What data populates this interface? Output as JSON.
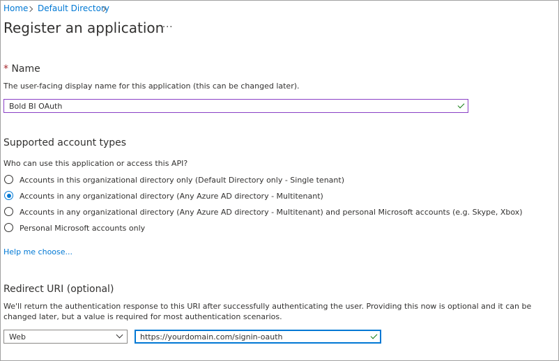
{
  "breadcrumb": {
    "items": [
      "Home",
      "Default Directory"
    ]
  },
  "header": {
    "title": "Register an application",
    "more_label": "···"
  },
  "name_section": {
    "required_marker": "*",
    "label": "Name",
    "description": "The user-facing display name for this application (this can be changed later).",
    "value": "Bold BI OAuth"
  },
  "account_types": {
    "heading": "Supported account types",
    "question": "Who can use this application or access this API?",
    "options": [
      "Accounts in this organizational directory only (Default Directory only - Single tenant)",
      "Accounts in any organizational directory (Any Azure AD directory - Multitenant)",
      "Accounts in any organizational directory (Any Azure AD directory - Multitenant) and personal Microsoft accounts (e.g. Skype, Xbox)",
      "Personal Microsoft accounts only"
    ],
    "selected_index": 1,
    "help_link": "Help me choose..."
  },
  "redirect": {
    "heading": "Redirect URI (optional)",
    "description_line1": "We'll return the authentication response to this URI after successfully authenticating the user. Providing this now is optional and it can be",
    "description_line2": "changed later, but a value is required for most authentication scenarios.",
    "platform_value": "Web",
    "uri_value": "https://yourdomain.com/signin-oauth"
  },
  "colors": {
    "accent": "#0078d4",
    "success": "#107c10",
    "required": "#a4262c",
    "focus_purple": "#8a3fc5"
  },
  "icons": [
    "chevron-right-icon",
    "more-icon",
    "checkmark-icon",
    "chevron-down-icon"
  ]
}
